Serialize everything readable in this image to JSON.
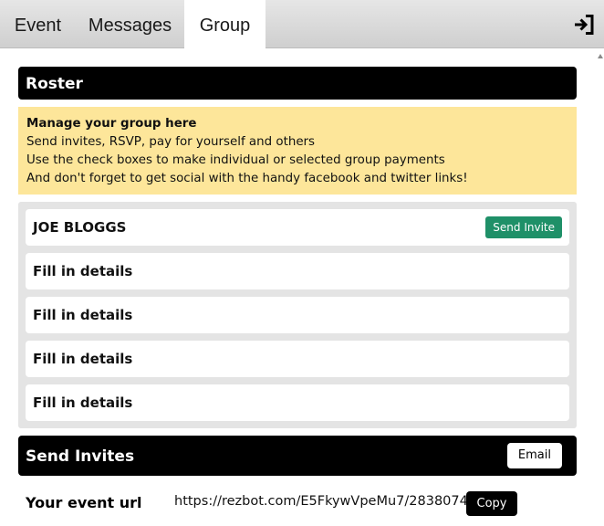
{
  "tabs": [
    {
      "label": "Event",
      "active": false
    },
    {
      "label": "Messages",
      "active": false
    },
    {
      "label": "Group",
      "active": true
    }
  ],
  "header_icon": "login-icon",
  "roster": {
    "title": "Roster",
    "notice": {
      "heading": "Manage your group here",
      "lines": [
        "Send invites, RSVP, pay for yourself and others",
        "Use the check boxes to make individual or selected group payments",
        "And don't forget to get social with the handy facebook and twitter links!"
      ],
      "background": "#fde69a"
    },
    "members": [
      {
        "name": "JOE BLOGGS",
        "action": "Send Invite"
      },
      {
        "name": "Fill in details"
      },
      {
        "name": "Fill in details"
      },
      {
        "name": "Fill in details"
      },
      {
        "name": "Fill in details"
      }
    ]
  },
  "send_invites": {
    "title": "Send Invites",
    "email_label": "Email",
    "event_url_label": "Your event url",
    "event_url": "https://rezbot.com/E5FkywVpeMu7/2838074",
    "copy_label": "Copy"
  },
  "colors": {
    "header_bg": "#000000",
    "invite_button": "#1f9068",
    "roster_box": "#e4e4e4"
  }
}
